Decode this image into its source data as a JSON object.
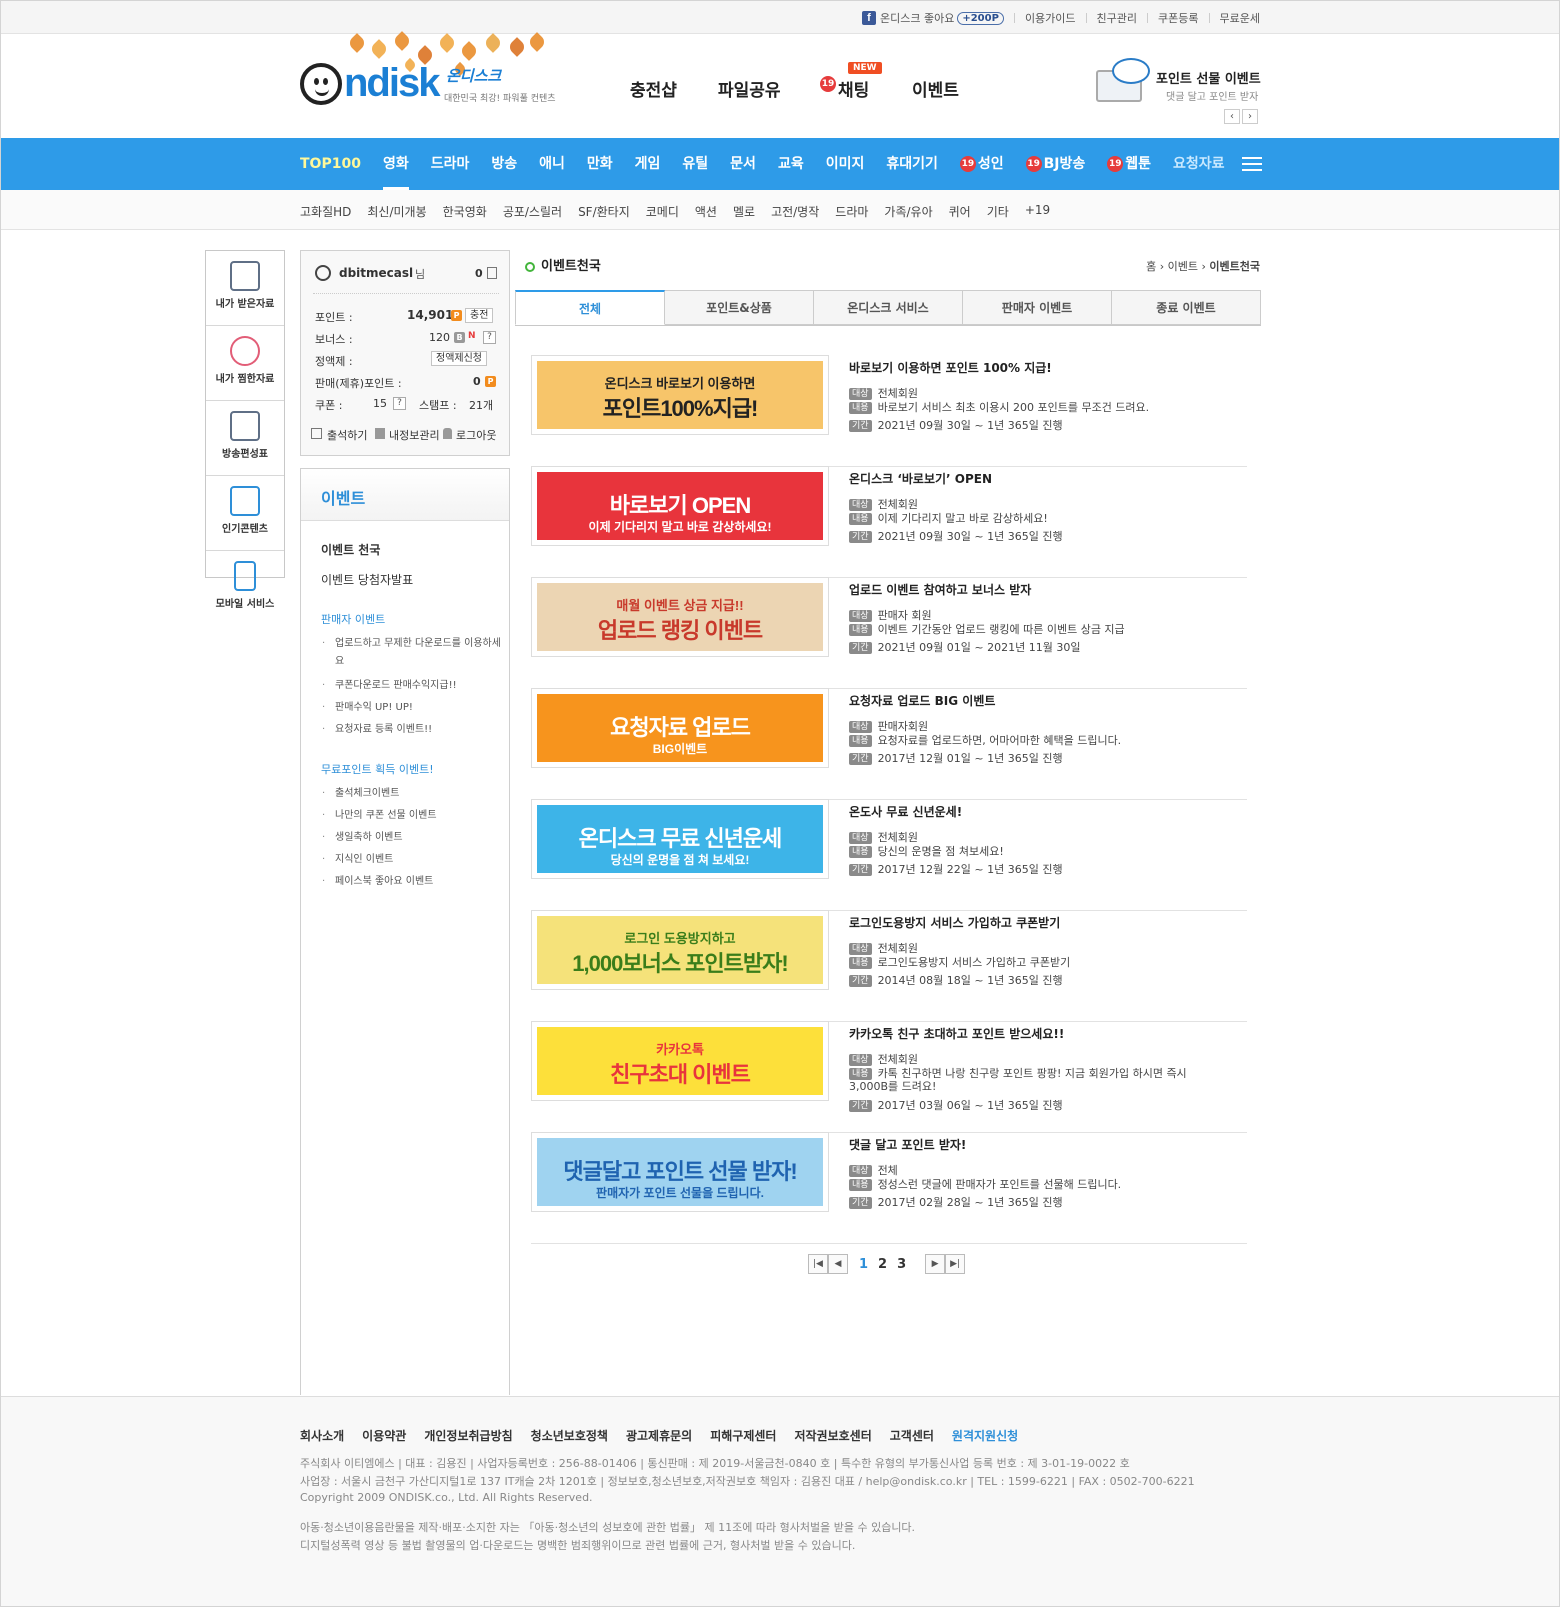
{
  "util": {
    "fb_label": "온디스크 좋아요",
    "fb_badge": "+200P",
    "links": [
      "이용가이드",
      "친구관리",
      "쿠폰등록",
      "무료운세"
    ]
  },
  "logo": {
    "word": "ndisk",
    "ko": "온디스크",
    "slogan": "대한민국 최강! 파워풀 컨텐츠"
  },
  "gnb": {
    "items": [
      "충전샵",
      "파일공유",
      "채팅",
      "이벤트"
    ],
    "new_tag": "NEW",
    "badge19": "19"
  },
  "promo": {
    "title": "포인트 선물 이벤트",
    "sub": "댓글 달고 포인트 받자",
    "prev": "‹",
    "next": "›"
  },
  "blue_nav": {
    "items": [
      "TOP100",
      "영화",
      "드라마",
      "방송",
      "애니",
      "만화",
      "게임",
      "유틸",
      "문서",
      "교육",
      "이미지",
      "휴대기기",
      "성인",
      "BJ방송",
      "웹툰",
      "요청자료"
    ],
    "active": "영화"
  },
  "sub_nav": [
    "고화질HD",
    "최신/미개봉",
    "한국영화",
    "공포/스릴러",
    "SF/환타지",
    "코메디",
    "액션",
    "멜로",
    "고전/명작",
    "드라마",
    "가족/유아",
    "퀴어",
    "기타",
    "+19"
  ],
  "quick": [
    "내가 받은자료",
    "내가 찜한자료",
    "방송편성표",
    "인기콘텐츠",
    "모바일 서비스"
  ],
  "profile": {
    "username": "dbitmecasl",
    "suffix": "님",
    "msg_count": "0",
    "point_label": "포인트 :",
    "point_value": "14,901",
    "charge_btn": "충전",
    "bonus_label": "보너스 :",
    "bonus_value": "120",
    "flat_label": "정액제 :",
    "flat_btn": "정액제신청",
    "sale_label": "판매(제휴)포인트 :",
    "sale_value": "0",
    "coupon_label": "쿠폰 :",
    "coupon_value": "15",
    "stamp_label": "스탬프 :",
    "stamp_value": "21개",
    "actions": [
      "출석하기",
      "내정보관리",
      "로그아웃"
    ]
  },
  "side": {
    "title": "이벤트",
    "l1": [
      "이벤트 천국",
      "이벤트 당첨자발표"
    ],
    "groups": [
      {
        "title": "판매자 이벤트",
        "items": [
          "업로드하고 무제한 다운로드를 이용하세요",
          "쿠폰다운로드 판매수익지급!!",
          "판매수익 UP! UP!",
          "요청자료 등록 이벤트!!"
        ]
      },
      {
        "title": "무료포인트 획득 이벤트!",
        "items": [
          "출석체크이벤트",
          "나만의 쿠폰 선물 이벤트",
          "생일축하 이벤트",
          "지식인 이벤트",
          "페이스북 좋아요 이벤트"
        ]
      }
    ]
  },
  "content": {
    "title": "이벤트천국",
    "crumb": [
      "홈",
      "이벤트",
      "이벤트천국"
    ],
    "tabs": [
      "전체",
      "포인트&상품",
      "온디스크 서비스",
      "판매자 이벤트",
      "종료 이벤트"
    ],
    "tag_target": "대상",
    "tag_content": "내용",
    "tag_period": "기간",
    "events": [
      {
        "title": "바로보기 이용하면 포인트 100% 지급!",
        "target": "전체회원",
        "content": "바로보기 서비스 최초 이용시 200 포인트를 무조건 드려요.",
        "period": "2021년 09월 30일 ~ 1년 365일 진행",
        "b1": "온디스크 바로보기 이용하면",
        "b2": "포인트100%지급!",
        "color": "#f7c56a",
        "fg": "#222"
      },
      {
        "title": "온디스크 ‘바로보기’ OPEN",
        "target": "전체회원",
        "content": "이제 기다리지 말고 바로 감상하세요!",
        "period": "2021년 09월 30일 ~ 1년 365일 진행",
        "b1": "",
        "b2": "바로보기 OPEN",
        "b3": "이제 기다리지 말고 바로 감상하세요!",
        "color": "#e8343c",
        "fg": "#fff"
      },
      {
        "title": "업로드 이벤트 참여하고 보너스 받자",
        "target": "판매자 회원",
        "content": "이벤트 기간동안 업로드 랭킹에 따른 이벤트 상금 지급",
        "period": "2021년 09월 01일 ~ 2021년 11월 30일",
        "b1": "매월 이벤트 상금 지급!!",
        "b2": "업로드 랭킹 이벤트",
        "color": "#ecd5b3",
        "fg": "#c8392b"
      },
      {
        "title": "요청자료 업로드 BIG 이벤트",
        "target": "판매자회원",
        "content": "요청자료를 업로드하면, 어마어마한 혜택을 드립니다.",
        "period": "2017년 12월 01일 ~ 1년 365일 진행",
        "b1": "",
        "b2": "요청자료 업로드",
        "b3": "BIG이벤트",
        "color": "#f7941d",
        "fg": "#fff"
      },
      {
        "title": "온도사 무료 신년운세!",
        "target": "전체회원",
        "content": "당신의 운명을 점 쳐보세요!",
        "period": "2017년 12월 22일 ~ 1년 365일 진행",
        "b1": "",
        "b2": "온디스크 무료 신년운세",
        "b3": "당신의 운명을 점 쳐 보세요!",
        "color": "#3db4e8",
        "fg": "#fff"
      },
      {
        "title": "로그인도용방지 서비스 가입하고 쿠폰받기",
        "target": "전체회원",
        "content": "로그인도용방지 서비스 가입하고 쿠폰받기",
        "period": "2014년 08월 18일 ~ 1년 365일 진행",
        "b1": "로그인 도용방지하고",
        "b2": "1,000보너스 포인트받자!",
        "color": "#f5e27a",
        "fg": "#3a7d1a"
      },
      {
        "title": "카카오톡 친구 초대하고 포인트 받으세요!!",
        "target": "전체회원",
        "content": "카톡 친구하면 나랑 친구랑 포인트 팡팡! 지금 회원가입 하시면 즉시 3,000B를 드려요!",
        "period": "2017년 03월 06일 ~ 1년 365일 진행",
        "b1": "카카오톡",
        "b2": "친구초대 이벤트",
        "color": "#fde03a",
        "fg": "#e8343c"
      },
      {
        "title": "댓글 달고 포인트 받자!",
        "target": "전체",
        "content": "정성스런 댓글에 판매자가 포인트를 선물해 드립니다.",
        "period": "2017년 02월 28일 ~ 1년 365일 진행",
        "b1": "",
        "b2": "댓글달고 포인트 선물 받자!",
        "b3": "판매자가 포인트 선물을 드립니다.",
        "color": "#9fd3f0",
        "fg": "#1f63b0"
      }
    ],
    "pager": {
      "first": "|◀",
      "prev": "◀",
      "pages": [
        "1",
        "2",
        "3"
      ],
      "next": "▶",
      "last": "▶|"
    }
  },
  "footer": {
    "links": [
      "회사소개",
      "이용약관",
      "개인정보취급방침",
      "청소년보호정책",
      "광고제휴문의",
      "피해구제센터",
      "저작권보호센터",
      "고객센터",
      "원격지원신청"
    ],
    "info1": "주식회사 이티엠에스 | 대표 : 김용진 | 사업자등록번호 : 256-88-01406 | 통신판매 : 제 2019-서울금천-0840 호 | 특수한 유형의 부가통신사업 등록 번호 : 제 3-01-19-0022 호",
    "info2": "사업장 : 서울시 금천구 가산디지털1로 137 IT캐슬 2차 1201호 | 정보보호,청소년보호,저작권보호 책임자 : 김용진 대표 / help@ondisk.co.kr | TEL : 1599-6221 | FAX : 0502-700-6221",
    "copyright": "Copyright 2009 ONDISK.co., Ltd. All Rights Reserved.",
    "notice1": "아동·청소년이용음란물을 제작·배포·소지한 자는 「아동·청소년의 성보호에 관한 법률」 제 11조에 따라 형사처벌을 받을 수 있습니다.",
    "notice2": "디지털성폭력 영상 등 불법 촬영물의 업·다운로드는 명백한 범죄행위이므로 관련 법률에 근거, 형사처벌 받을 수 있습니다."
  }
}
